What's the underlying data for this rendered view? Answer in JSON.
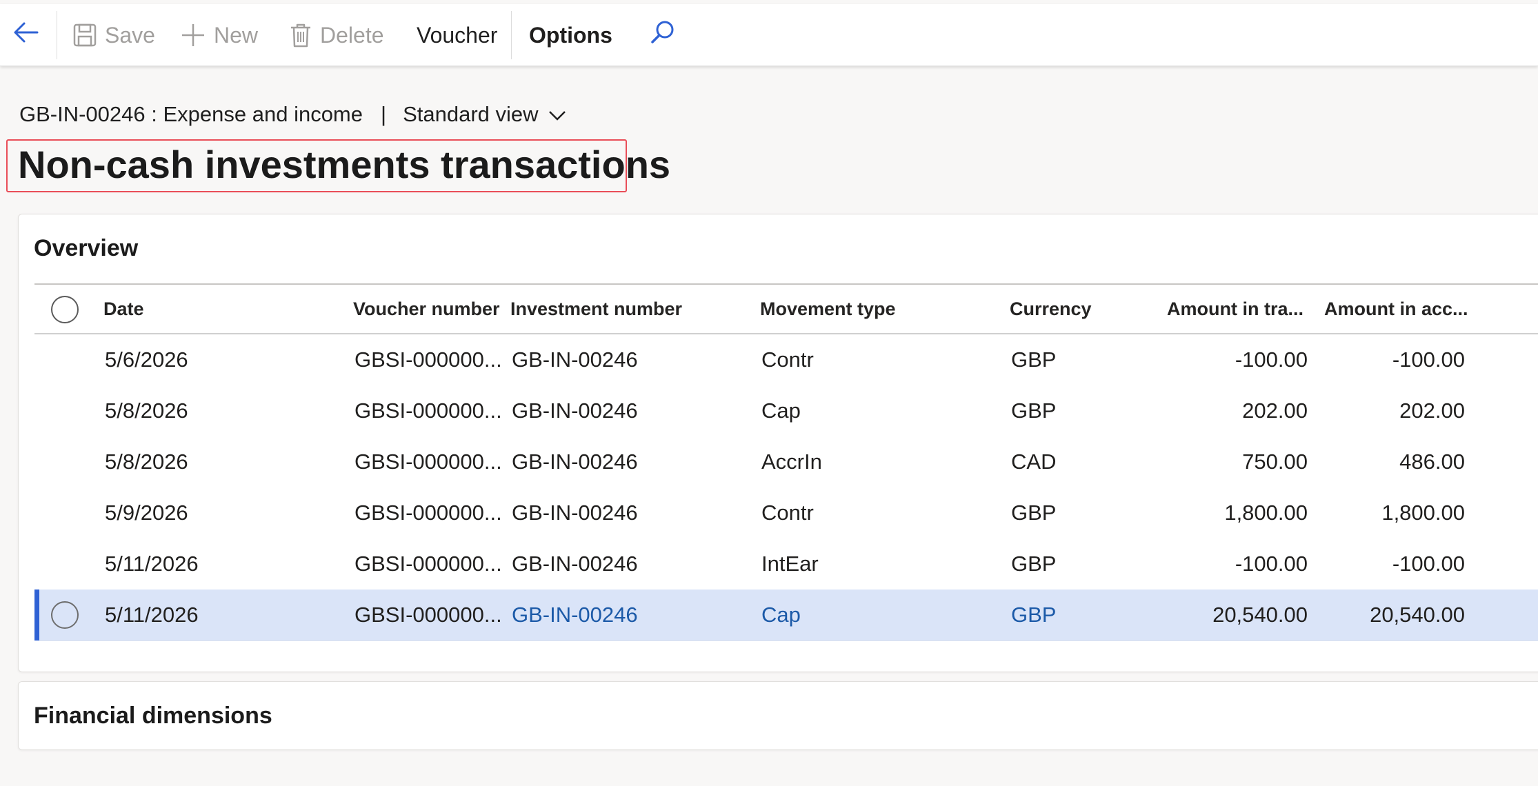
{
  "toolbar": {
    "save_label": "Save",
    "new_label": "New",
    "delete_label": "Delete",
    "voucher_label": "Voucher",
    "options_label": "Options",
    "icons": [
      "back-arrow-icon",
      "save-icon",
      "plus-icon",
      "delete-icon",
      "search-icon"
    ]
  },
  "header": {
    "breadcrumb": "GB-IN-00246 : Expense and income",
    "separator": "|",
    "view": "Standard view",
    "title": "Non-cash investments transactions"
  },
  "overview": {
    "title": "Overview",
    "columns": {
      "date": "Date",
      "voucher": "Voucher number",
      "investment": "Investment number",
      "movement": "Movement type",
      "currency": "Currency",
      "amount_tra": "Amount in tra...",
      "amount_acc": "Amount in acc..."
    },
    "rows": [
      {
        "date": "5/6/2026",
        "voucher": "GBSI-000000...",
        "investment": "GB-IN-00246",
        "movement": "Contr",
        "currency": "GBP",
        "amount_tra": "-100.00",
        "amount_acc": "-100.00"
      },
      {
        "date": "5/8/2026",
        "voucher": "GBSI-000000...",
        "investment": "GB-IN-00246",
        "movement": "Cap",
        "currency": "GBP",
        "amount_tra": "202.00",
        "amount_acc": "202.00"
      },
      {
        "date": "5/8/2026",
        "voucher": "GBSI-000000...",
        "investment": "GB-IN-00246",
        "movement": "AccrIn",
        "currency": "CAD",
        "amount_tra": "750.00",
        "amount_acc": "486.00"
      },
      {
        "date": "5/9/2026",
        "voucher": "GBSI-000000...",
        "investment": "GB-IN-00246",
        "movement": "Contr",
        "currency": "GBP",
        "amount_tra": "1,800.00",
        "amount_acc": "1,800.00"
      },
      {
        "date": "5/11/2026",
        "voucher": "GBSI-000000...",
        "investment": "GB-IN-00246",
        "movement": "IntEar",
        "currency": "GBP",
        "amount_tra": "-100.00",
        "amount_acc": "-100.00"
      },
      {
        "date": "5/11/2026",
        "voucher": "GBSI-000000...",
        "investment": "GB-IN-00246",
        "movement": "Cap",
        "currency": "GBP",
        "amount_tra": "20,540.00",
        "amount_acc": "20,540.00"
      }
    ],
    "selected_row": 5
  },
  "financial_dimensions": {
    "title": "Financial dimensions"
  },
  "colors": {
    "accent": "#2e61d4",
    "link": "#1c5aa8",
    "selected_row_bg": "#dae4f8",
    "highlight_border": "#e94e58",
    "disabled_text": "#a19f9d"
  }
}
